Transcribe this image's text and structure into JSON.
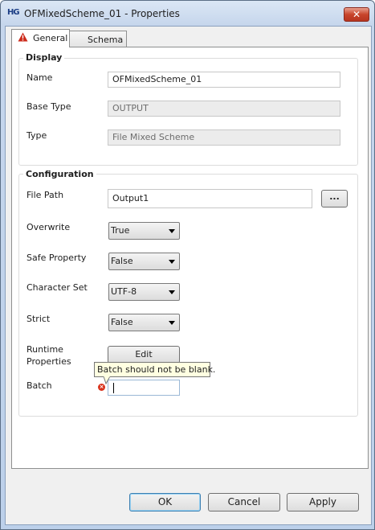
{
  "window": {
    "title": "OFMixedScheme_01 - Properties",
    "app_icon_text": "HG",
    "close_label": "✕"
  },
  "tabs": [
    {
      "label": "General",
      "has_warning": true,
      "selected": true
    },
    {
      "label": "Schema",
      "selected": false
    }
  ],
  "display": {
    "title": "Display",
    "name": {
      "label": "Name",
      "value": "OFMixedScheme_01"
    },
    "base_type": {
      "label": "Base Type",
      "value": "OUTPUT"
    },
    "type": {
      "label": "Type",
      "value": "File Mixed Scheme"
    }
  },
  "configuration": {
    "title": "Configuration",
    "file_path": {
      "label": "File Path",
      "value": "Output1",
      "browse_label": "..."
    },
    "overwrite": {
      "label": "Overwrite",
      "value": "True"
    },
    "safe_property": {
      "label": "Safe Property",
      "value": "False"
    },
    "character_set": {
      "label": "Character Set",
      "value": "UTF-8"
    },
    "strict": {
      "label": "Strict",
      "value": "False"
    },
    "runtime_properties": {
      "label_line1": "Runtime",
      "label_line2": "Properties",
      "button_label": "Edit"
    },
    "batch": {
      "label": "Batch",
      "value": "",
      "error_tooltip": "Batch should not be blank."
    }
  },
  "buttons": {
    "ok": "OK",
    "cancel": "Cancel",
    "apply": "Apply"
  },
  "colors": {
    "error": "#d9331c",
    "tooltip_bg": "#ffffe1",
    "warning": "#cc2a1a"
  }
}
